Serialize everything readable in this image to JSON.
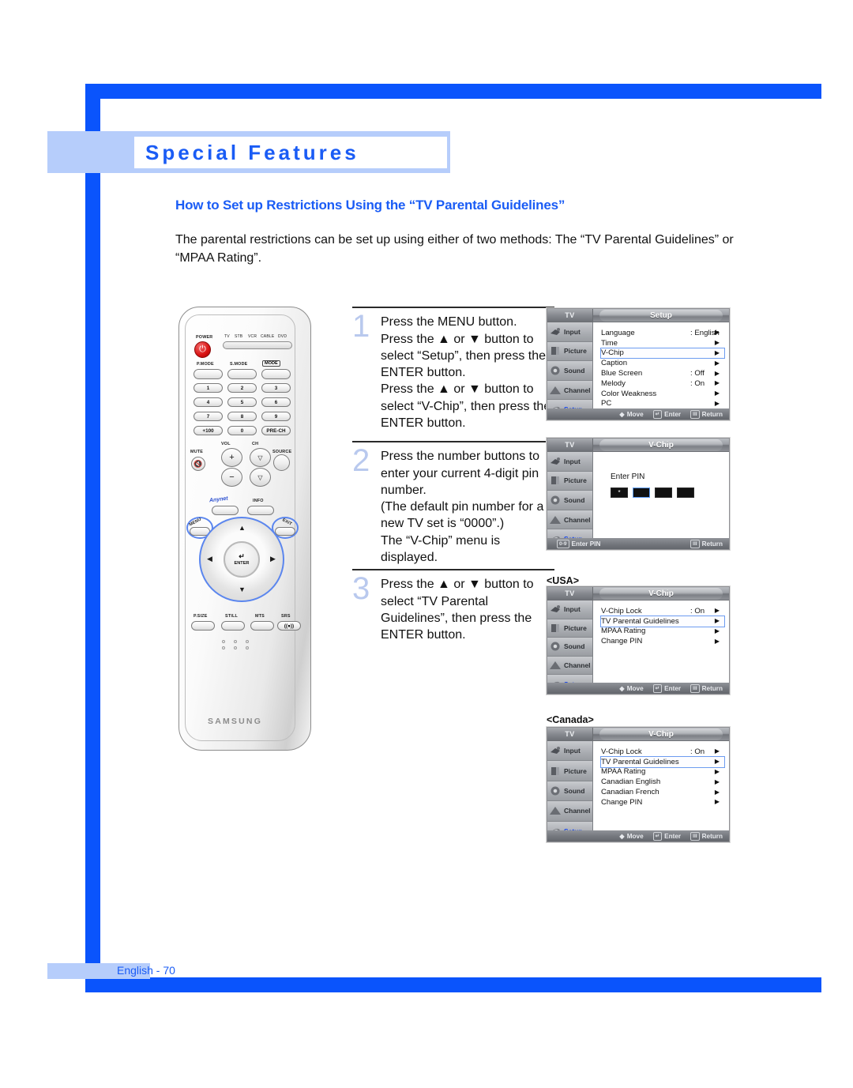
{
  "page": {
    "chapter_title": "Special Features",
    "section_heading": "How to Set up Restrictions Using the “TV Parental Guidelines”",
    "intro_paragraph": "The parental restrictions can be set up using either of two methods: The “TV Parental Guidelines” or “MPAA Rating”.",
    "footer": "English - 70"
  },
  "steps": [
    {
      "number": "1",
      "text": "Press the MENU button.\nPress the ▲ or ▼ button to select “Setup”, then press the ENTER button.\nPress the ▲ or ▼ button to select “V-Chip”, then press the ENTER button."
    },
    {
      "number": "2",
      "text": "Press the number buttons to enter your current 4-digit pin number.\n(The default pin number for a new TV set is “0000”.)\nThe “V-Chip” menu is displayed."
    },
    {
      "number": "3",
      "text": "Press the ▲ or ▼ button to select “TV Parental Guidelines”, then press the ENTER button."
    }
  ],
  "remote": {
    "power_label": "POWER",
    "mode_labels": [
      "TV",
      "STB",
      "VCR",
      "CABLE",
      "DVD"
    ],
    "pmode": "P.MODE",
    "smode": "S.MODE",
    "mode": "MODE",
    "keypad": [
      "1",
      "2",
      "3",
      "4",
      "5",
      "6",
      "7",
      "8",
      "9",
      "+100",
      "0",
      "PRE-CH"
    ],
    "mute": "MUTE",
    "vol": "VOL",
    "ch": "CH",
    "source": "SOURCE",
    "anynet": "Anynet",
    "info": "INFO",
    "menu": "MENU",
    "exit": "EXIT",
    "enter": "ENTER",
    "bottom_row": [
      "P.SIZE",
      "STILL",
      "MTS",
      "SRS"
    ],
    "brand": "SAMSUNG"
  },
  "osd_nav": [
    {
      "label": "Input",
      "icon": "input-icon",
      "active": false
    },
    {
      "label": "Picture",
      "icon": "picture-icon",
      "active": false
    },
    {
      "label": "Sound",
      "icon": "sound-icon",
      "active": false
    },
    {
      "label": "Channel",
      "icon": "channel-icon",
      "active": false
    },
    {
      "label": "Setup",
      "icon": "setup-icon",
      "active": true
    }
  ],
  "osd_tv_tab": "TV",
  "menus": {
    "setup": {
      "title": "Setup",
      "rows": [
        {
          "label": "Language",
          "value": ": English",
          "selected": false
        },
        {
          "label": "Time",
          "value": "",
          "selected": false
        },
        {
          "label": "V-Chip",
          "value": "",
          "selected": true
        },
        {
          "label": "Caption",
          "value": "",
          "selected": false
        },
        {
          "label": "Blue Screen",
          "value": ": Off",
          "selected": false
        },
        {
          "label": "Melody",
          "value": ": On",
          "selected": false
        },
        {
          "label": "Color Weakness",
          "value": "",
          "selected": false
        },
        {
          "label": "PC",
          "value": "",
          "selected": false
        }
      ],
      "status": {
        "move": "Move",
        "enter": "Enter",
        "return": "Return"
      }
    },
    "pin": {
      "title": "V-Chip",
      "prompt": "Enter PIN",
      "digits": [
        "*",
        "",
        "",
        ""
      ],
      "current_index": 1,
      "status": {
        "keys": "0-9",
        "enter_pin": "Enter PIN",
        "return": "Return"
      }
    },
    "usa": {
      "region": "<USA>",
      "title": "V-Chip",
      "rows": [
        {
          "label": "V-Chip Lock",
          "value": ": On",
          "selected": false
        },
        {
          "label": "TV Parental Guidelines",
          "value": "",
          "selected": true
        },
        {
          "label": "MPAA Rating",
          "value": "",
          "selected": false
        },
        {
          "label": "Change PIN",
          "value": "",
          "selected": false
        }
      ],
      "status": {
        "move": "Move",
        "enter": "Enter",
        "return": "Return"
      }
    },
    "canada": {
      "region": "<Canada>",
      "title": "V-Chip",
      "rows": [
        {
          "label": "V-Chip Lock",
          "value": ": On",
          "selected": false
        },
        {
          "label": "TV Parental Guidelines",
          "value": "",
          "selected": true
        },
        {
          "label": "MPAA Rating",
          "value": "",
          "selected": false
        },
        {
          "label": "Canadian English",
          "value": "",
          "selected": false
        },
        {
          "label": "Canadian French",
          "value": "",
          "selected": false
        },
        {
          "label": "Change PIN",
          "value": "",
          "selected": false
        }
      ],
      "status": {
        "move": "Move",
        "enter": "Enter",
        "return": "Return"
      }
    }
  },
  "colors": {
    "brand_blue": "#0a54fc",
    "accent_light_blue": "#b6cdfb",
    "heading_blue": "#1a5cf5",
    "step_number": "#b9c9ee"
  }
}
